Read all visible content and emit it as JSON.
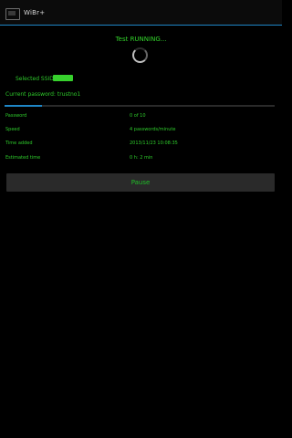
{
  "app": {
    "title": "WiBr+"
  },
  "status": {
    "text": "Test RUNNING..."
  },
  "ssid": {
    "label": "Selected SSID:",
    "value": ""
  },
  "current_password": {
    "text": "Current password: trustno1"
  },
  "progress": {
    "value": 0.14
  },
  "stats": [
    {
      "label": "Password",
      "value": "0 of 10"
    },
    {
      "label": "Speed",
      "value": "4 passwords/minute"
    },
    {
      "label": "Time added",
      "value": "2013/11/23 10:08:35"
    },
    {
      "label": "Estimated time",
      "value": "0 h: 2 min"
    }
  ],
  "buttons": {
    "pause": "Pause"
  },
  "colors": {
    "accent": "#1f86c6",
    "text": "#2ecb2b",
    "button_bg": "#2a2a2a"
  }
}
